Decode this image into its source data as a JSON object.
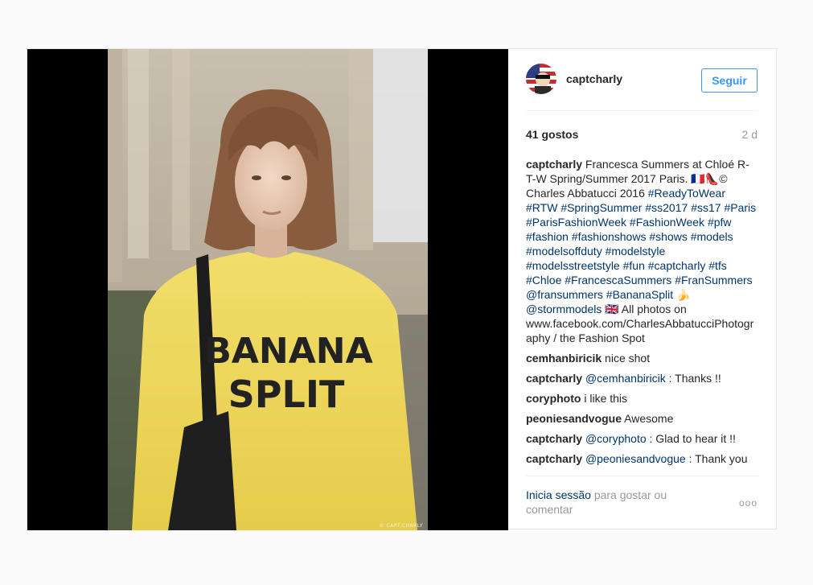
{
  "post": {
    "watermark": "© CAPT.CHARLY",
    "shirt_text_line1": "BANANA",
    "shirt_text_line2": "SPLIT",
    "author": "captcharly",
    "follow_label": "Seguir",
    "likes": "41 gostos",
    "time": "2 d"
  },
  "caption": {
    "user": "captcharly",
    "parts": [
      {
        "t": "text",
        "v": " Francesca Summers at Chloé R-T-W Spring/Summer 2017 Paris. 🇫🇷👠© Charles Abbatucci 2016 "
      },
      {
        "t": "link",
        "v": "#ReadyToWear"
      },
      {
        "t": "text",
        "v": " "
      },
      {
        "t": "link",
        "v": "#RTW"
      },
      {
        "t": "text",
        "v": " "
      },
      {
        "t": "link",
        "v": "#SpringSummer"
      },
      {
        "t": "text",
        "v": " "
      },
      {
        "t": "link",
        "v": "#ss2017"
      },
      {
        "t": "text",
        "v": " "
      },
      {
        "t": "link",
        "v": "#ss17"
      },
      {
        "t": "text",
        "v": " "
      },
      {
        "t": "link",
        "v": "#Paris"
      },
      {
        "t": "text",
        "v": " "
      },
      {
        "t": "link",
        "v": "#ParisFashionWeek"
      },
      {
        "t": "text",
        "v": " "
      },
      {
        "t": "link",
        "v": "#FashionWeek"
      },
      {
        "t": "text",
        "v": " "
      },
      {
        "t": "link",
        "v": "#pfw"
      },
      {
        "t": "text",
        "v": " "
      },
      {
        "t": "link",
        "v": "#fashion"
      },
      {
        "t": "text",
        "v": " "
      },
      {
        "t": "link",
        "v": "#fashionshows"
      },
      {
        "t": "text",
        "v": " "
      },
      {
        "t": "link",
        "v": "#shows"
      },
      {
        "t": "text",
        "v": " "
      },
      {
        "t": "link",
        "v": "#models"
      },
      {
        "t": "text",
        "v": " "
      },
      {
        "t": "link",
        "v": "#modelsoffduty"
      },
      {
        "t": "text",
        "v": " "
      },
      {
        "t": "link",
        "v": "#modelstyle"
      },
      {
        "t": "text",
        "v": " "
      },
      {
        "t": "link",
        "v": "#modelsstreetstyle"
      },
      {
        "t": "text",
        "v": " "
      },
      {
        "t": "link",
        "v": "#fun"
      },
      {
        "t": "text",
        "v": " "
      },
      {
        "t": "link",
        "v": "#captcharly"
      },
      {
        "t": "text",
        "v": " "
      },
      {
        "t": "link",
        "v": "#tfs"
      },
      {
        "t": "text",
        "v": " "
      },
      {
        "t": "link",
        "v": "#Chloe"
      },
      {
        "t": "text",
        "v": " "
      },
      {
        "t": "link",
        "v": "#FrancescaSummers"
      },
      {
        "t": "text",
        "v": " "
      },
      {
        "t": "link",
        "v": "#FranSummers"
      },
      {
        "t": "text",
        "v": " "
      },
      {
        "t": "link",
        "v": "@fransummers"
      },
      {
        "t": "text",
        "v": " "
      },
      {
        "t": "link",
        "v": "#BananaSplit"
      },
      {
        "t": "text",
        "v": " 🍌 "
      },
      {
        "t": "link",
        "v": "@stormmodels"
      },
      {
        "t": "text",
        "v": " 🇬🇧 All photos on www.facebook.com/CharlesAbbatucciPhotography / the Fashion Spot"
      }
    ]
  },
  "comments": [
    {
      "user": "cemhanbiricik",
      "parts": [
        {
          "t": "text",
          "v": " nice shot"
        }
      ]
    },
    {
      "user": "captcharly",
      "parts": [
        {
          "t": "text",
          "v": " "
        },
        {
          "t": "link",
          "v": "@cemhanbiricik"
        },
        {
          "t": "text",
          "v": " : Thanks !!"
        }
      ]
    },
    {
      "user": "coryphoto",
      "parts": [
        {
          "t": "text",
          "v": " i like this"
        }
      ]
    },
    {
      "user": "peoniesandvogue",
      "parts": [
        {
          "t": "text",
          "v": " Awesome"
        }
      ]
    },
    {
      "user": "captcharly",
      "parts": [
        {
          "t": "text",
          "v": " "
        },
        {
          "t": "link",
          "v": "@coryphoto"
        },
        {
          "t": "text",
          "v": " : Glad to hear it !!"
        }
      ]
    },
    {
      "user": "captcharly",
      "parts": [
        {
          "t": "text",
          "v": " "
        },
        {
          "t": "link",
          "v": "@peoniesandvogue"
        },
        {
          "t": "text",
          "v": " : Thank you"
        }
      ]
    }
  ],
  "footer": {
    "login_link": "Inicia sessão",
    "login_rest": " para gostar ou comentar",
    "more": "ooo"
  },
  "colors": {
    "link": "#003569",
    "follow_blue": "#3897f0",
    "muted": "#999999",
    "shirt_yellow": "#f2dc5d"
  }
}
